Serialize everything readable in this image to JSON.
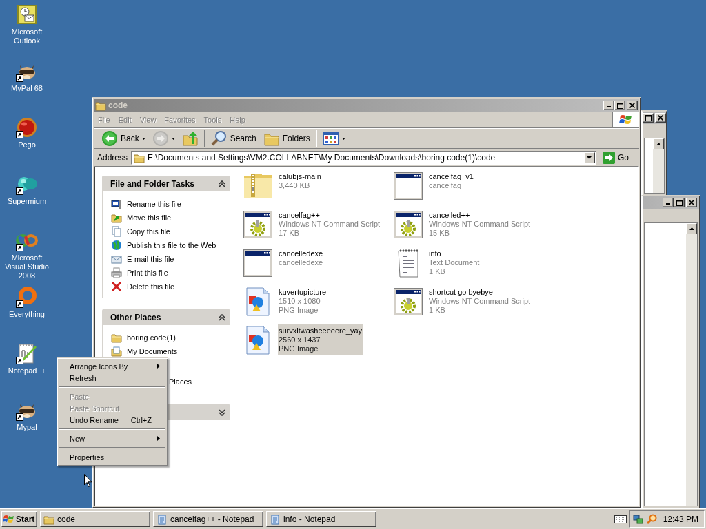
{
  "desktop_icons": [
    {
      "label": "Microsoft Outlook",
      "kind": "outlook",
      "shortcut": false
    },
    {
      "label": "MyPal 68",
      "kind": "animal",
      "shortcut": true
    },
    {
      "label": "Pego",
      "kind": "orb",
      "shortcut": true
    },
    {
      "label": "Supermium",
      "kind": "blob",
      "shortcut": true
    },
    {
      "label": "Microsoft Visual Studio 2008",
      "kind": "infinity",
      "shortcut": true
    },
    {
      "label": "Everything",
      "kind": "ring",
      "shortcut": true
    },
    {
      "label": "Notepad++",
      "kind": "notepad",
      "shortcut": true
    },
    {
      "label": "Mypal",
      "kind": "animal",
      "shortcut": true
    }
  ],
  "explorer": {
    "title": "code",
    "menu": [
      {
        "label": "File",
        "disabled": true
      },
      {
        "label": "Edit",
        "disabled": true
      },
      {
        "label": "View",
        "disabled": true
      },
      {
        "label": "Favorites",
        "disabled": true
      },
      {
        "label": "Tools",
        "disabled": true
      },
      {
        "label": "Help",
        "disabled": true
      }
    ],
    "toolbar": [
      [
        {
          "kind": "back",
          "label": "Back",
          "disabled": false,
          "dropdown": true
        },
        {
          "kind": "forward",
          "disabled": true,
          "dropdown": true
        },
        {
          "kind": "up",
          "disabled": false
        }
      ],
      [
        {
          "kind": "search",
          "label": "Search",
          "disabled": false
        },
        {
          "kind": "folders",
          "label": "Folders",
          "disabled": false
        }
      ],
      [
        {
          "kind": "views",
          "disabled": false,
          "dropdown": true
        }
      ]
    ],
    "address": {
      "label": "Address",
      "value": "E:\\Documents and Settings\\VM2.COLLABNET\\My Documents\\Downloads\\boring code(1)\\code",
      "go": "Go"
    },
    "task_panes": [
      {
        "title": "File and Folder Tasks",
        "expanded": true,
        "items": [
          {
            "label": "Rename this file",
            "kind": "rename"
          },
          {
            "label": "Move this file",
            "kind": "move"
          },
          {
            "label": "Copy this file",
            "kind": "copy"
          },
          {
            "label": "Publish this file to the Web",
            "kind": "publish"
          },
          {
            "label": "E-mail this file",
            "kind": "email"
          },
          {
            "label": "Print this file",
            "kind": "print"
          },
          {
            "label": "Delete this file",
            "kind": "delete"
          }
        ]
      },
      {
        "title": "Other Places",
        "expanded": true,
        "items": [
          {
            "label": "boring code(1)",
            "kind": "folder"
          },
          {
            "label": "My Documents",
            "kind": "documents"
          },
          {
            "label": "Places",
            "kind": "cut"
          }
        ]
      },
      {
        "expanded": false
      }
    ],
    "files": [
      {
        "name": "calubjs-main",
        "details": [
          "3,440 KB"
        ],
        "kind": "zip",
        "selected": false
      },
      {
        "name": "cancelfag_v1",
        "details": [
          "cancelfag"
        ],
        "kind": "window",
        "selected": false
      },
      {
        "name": "cancelfag++",
        "details": [
          "Windows NT Command Script",
          "17 KB"
        ],
        "kind": "script",
        "selected": false
      },
      {
        "name": "cancelled++",
        "details": [
          "Windows NT Command Script",
          "15 KB"
        ],
        "kind": "script",
        "selected": false
      },
      {
        "name": "cancelledexe",
        "details": [
          "cancelledexe"
        ],
        "kind": "window",
        "selected": false
      },
      {
        "name": "info",
        "details": [
          "Text Document",
          "1 KB"
        ],
        "kind": "text",
        "selected": false
      },
      {
        "name": "kuvertupicture",
        "details": [
          "1510 x 1080",
          "PNG Image"
        ],
        "kind": "image",
        "selected": false
      },
      {
        "name": "shortcut go byebye",
        "details": [
          "Windows NT Command Script",
          "1 KB"
        ],
        "kind": "script",
        "selected": false
      },
      {
        "name": "survxltwasheeeeere_yay",
        "details": [
          "2560 x 1437",
          "PNG Image"
        ],
        "kind": "image",
        "selected": true
      }
    ]
  },
  "context_menu": {
    "groups": [
      [
        {
          "label": "Arrange Icons By",
          "disabled": false,
          "submenu": true
        },
        {
          "label": "Refresh",
          "disabled": false,
          "submenu": false
        }
      ],
      [
        {
          "label": "Paste",
          "disabled": true,
          "submenu": false
        },
        {
          "label": "Paste Shortcut",
          "disabled": true,
          "submenu": false
        },
        {
          "label": "Undo Rename",
          "shortcut": "Ctrl+Z",
          "disabled": false,
          "submenu": false
        }
      ],
      [
        {
          "label": "New",
          "disabled": false,
          "submenu": true
        }
      ],
      [
        {
          "label": "Properties",
          "disabled": false,
          "submenu": false
        }
      ]
    ]
  },
  "taskbar": {
    "start": "Start",
    "tasks": [
      {
        "label": "code",
        "kind": "folder",
        "selected": false
      },
      {
        "label": "cancelfag++ - Notepad",
        "kind": "notepad",
        "selected": false
      },
      {
        "label": "info - Notepad",
        "kind": "notepad",
        "selected": false
      }
    ],
    "clock": "12:43 PM"
  }
}
